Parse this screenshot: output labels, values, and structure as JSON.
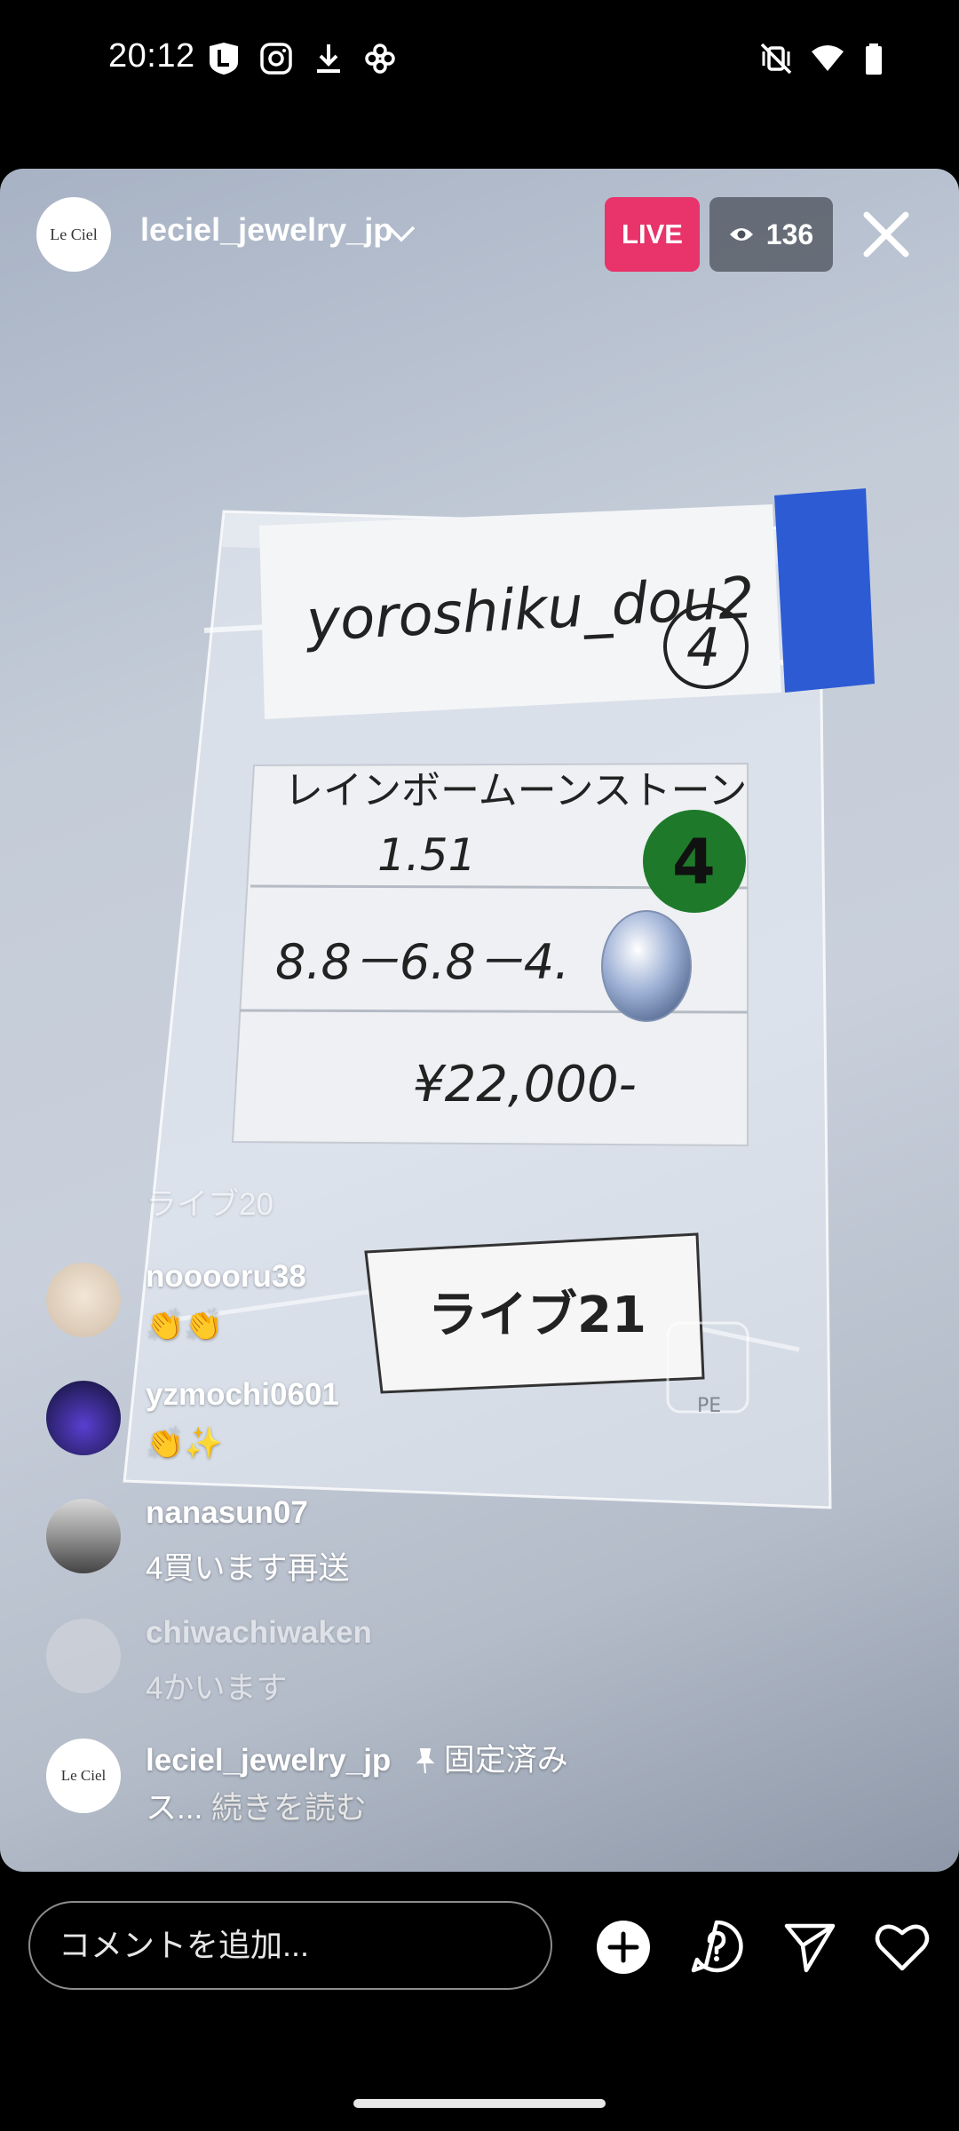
{
  "status_bar": {
    "time": "20:12",
    "left_icons": [
      "L-app-icon",
      "instagram-icon",
      "download-icon",
      "pinwheel-icon"
    ],
    "right_icons": [
      "vibrate-mute-icon",
      "wifi-icon",
      "battery-icon"
    ]
  },
  "live": {
    "host_avatar_text": "Le Ciel",
    "host_username": "leciel_jewelry_jp",
    "live_label": "LIVE",
    "viewer_count": "136"
  },
  "product_card": {
    "handwritten_top": "yoroshiku_dou2",
    "handwritten_number": "4",
    "stone_name": "レインボームーンストーン",
    "weight": "1.51",
    "sticker": "4",
    "dimensions": "8.8－6.8－4.",
    "price": "¥22,000-",
    "live_tag": "ライブ21",
    "bag_mark": "PE"
  },
  "comments": [
    {
      "user": "",
      "text": "ライブ20",
      "faded": true
    },
    {
      "user": "nooooru38",
      "text": "👏👏"
    },
    {
      "user": "yzmochi0601",
      "text": "👏✨"
    },
    {
      "user": "nanasun07",
      "text": "4買います再送"
    },
    {
      "user": "chiwachiwaken",
      "text": "4かいます"
    },
    {
      "user": "leciel_jewelry_jp",
      "pinned_label": "固定済み",
      "text": "ス...",
      "read_more": "続きを読む",
      "avatar_text": "Le Ciel"
    }
  ],
  "bottom_bar": {
    "comment_placeholder": "コメントを追加...",
    "icons": [
      "add-icon",
      "question-icon",
      "send-icon",
      "heart-icon"
    ]
  },
  "colors": {
    "live_badge": "#e8336b",
    "background": "#000000"
  }
}
